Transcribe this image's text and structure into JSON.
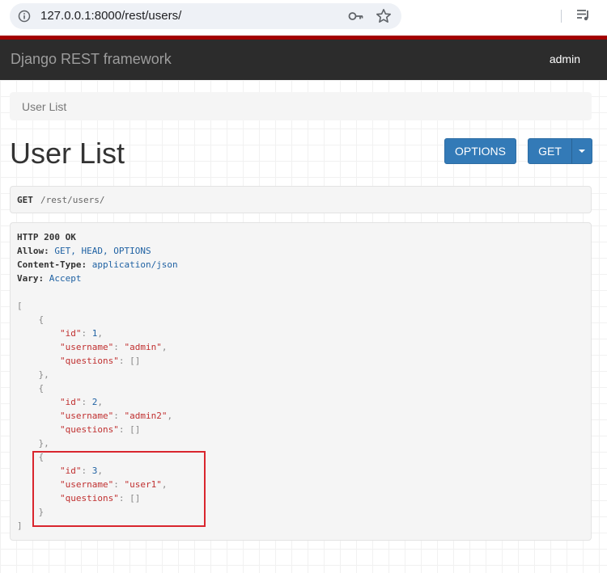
{
  "browser": {
    "url": "127.0.0.1:8000/rest/users/"
  },
  "navbar": {
    "brand": "Django REST framework",
    "user": "admin"
  },
  "breadcrumb": {
    "item": "User List"
  },
  "page": {
    "title": "User List",
    "options_button": "OPTIONS",
    "get_button": "GET"
  },
  "request": {
    "method": "GET",
    "path": "/rest/users/"
  },
  "response": {
    "status": "HTTP 200 OK",
    "headers": [
      {
        "key": "Allow:",
        "value": "GET, HEAD, OPTIONS"
      },
      {
        "key": "Content-Type:",
        "value": "application/json"
      },
      {
        "key": "Vary:",
        "value": "Accept"
      }
    ],
    "users": [
      {
        "id": "1",
        "username": "\"admin\""
      },
      {
        "id": "2",
        "username": "\"admin2\""
      },
      {
        "id": "3",
        "username": "\"user1\""
      }
    ],
    "keys": {
      "id": "\"id\"",
      "username": "\"username\"",
      "questions": "\"questions\""
    },
    "empty_list": "[]"
  },
  "colors": {
    "navbar": "#2c2c2c",
    "accent_strip": "#a30000",
    "button": "#337ab7",
    "highlight": "#d9262e"
  },
  "icons": [
    "info-icon",
    "key-icon",
    "star-icon",
    "reading-list-icon",
    "caret-down-icon"
  ]
}
